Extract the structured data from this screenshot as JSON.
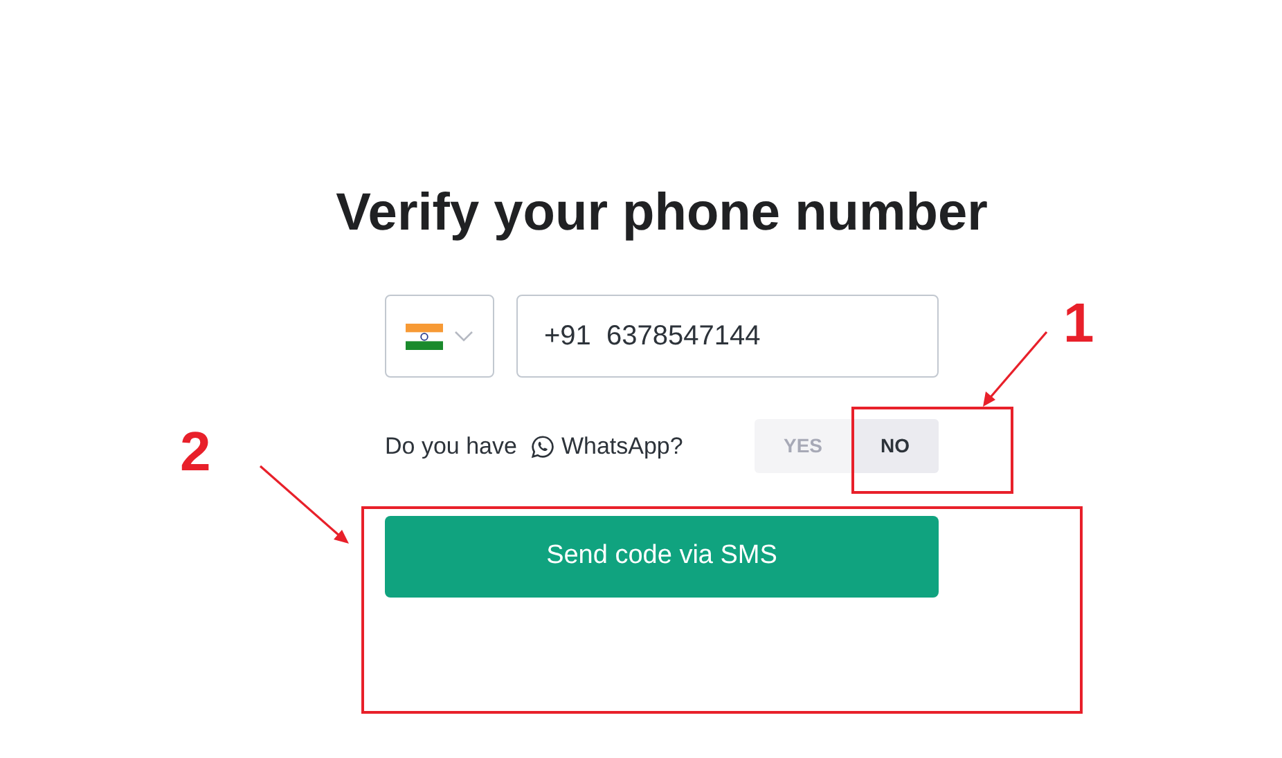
{
  "title": "Verify your phone number",
  "phone": {
    "value": "+91  6378547144"
  },
  "whatsapp": {
    "label_before": "Do you have",
    "label_after": "WhatsApp?",
    "options": [
      {
        "label": "YES",
        "selected": false
      },
      {
        "label": "NO",
        "selected": true
      }
    ]
  },
  "submit_button": "Send code via SMS",
  "annotations": [
    {
      "label": "1"
    },
    {
      "label": "2"
    }
  ]
}
